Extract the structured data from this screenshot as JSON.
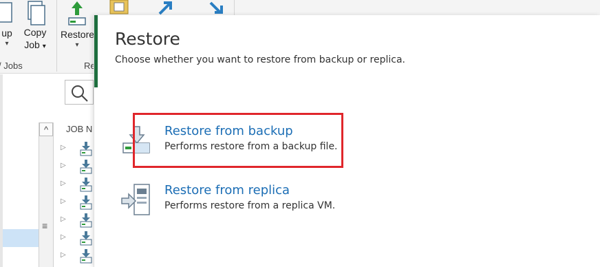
{
  "ribbon": {
    "backup_label": "up",
    "copy_job_label_1": "Copy",
    "copy_job_label_2": "Job",
    "restore_label": "Restore",
    "group_jobs_label": "Jobs",
    "group_restore_label": "Re",
    "dropdown_glyph": "▾"
  },
  "tree": {
    "column_header": "JOB N",
    "expand_glyph": "▷",
    "scroll_up_glyph": "^",
    "scroll_grip_glyph": "≡"
  },
  "dialog": {
    "title": "Restore",
    "subtitle": "Choose whether you want to restore from backup or replica.",
    "options": [
      {
        "title": "Restore from backup",
        "description": "Performs restore from a backup file.",
        "icon": "restore-backup-icon"
      },
      {
        "title": "Restore from replica",
        "description": "Performs restore from a replica VM.",
        "icon": "restore-replica-icon"
      }
    ]
  },
  "colors": {
    "link_blue": "#1c6eb5",
    "accent_green": "#1e6e3e",
    "highlight_red": "#e0262b"
  }
}
